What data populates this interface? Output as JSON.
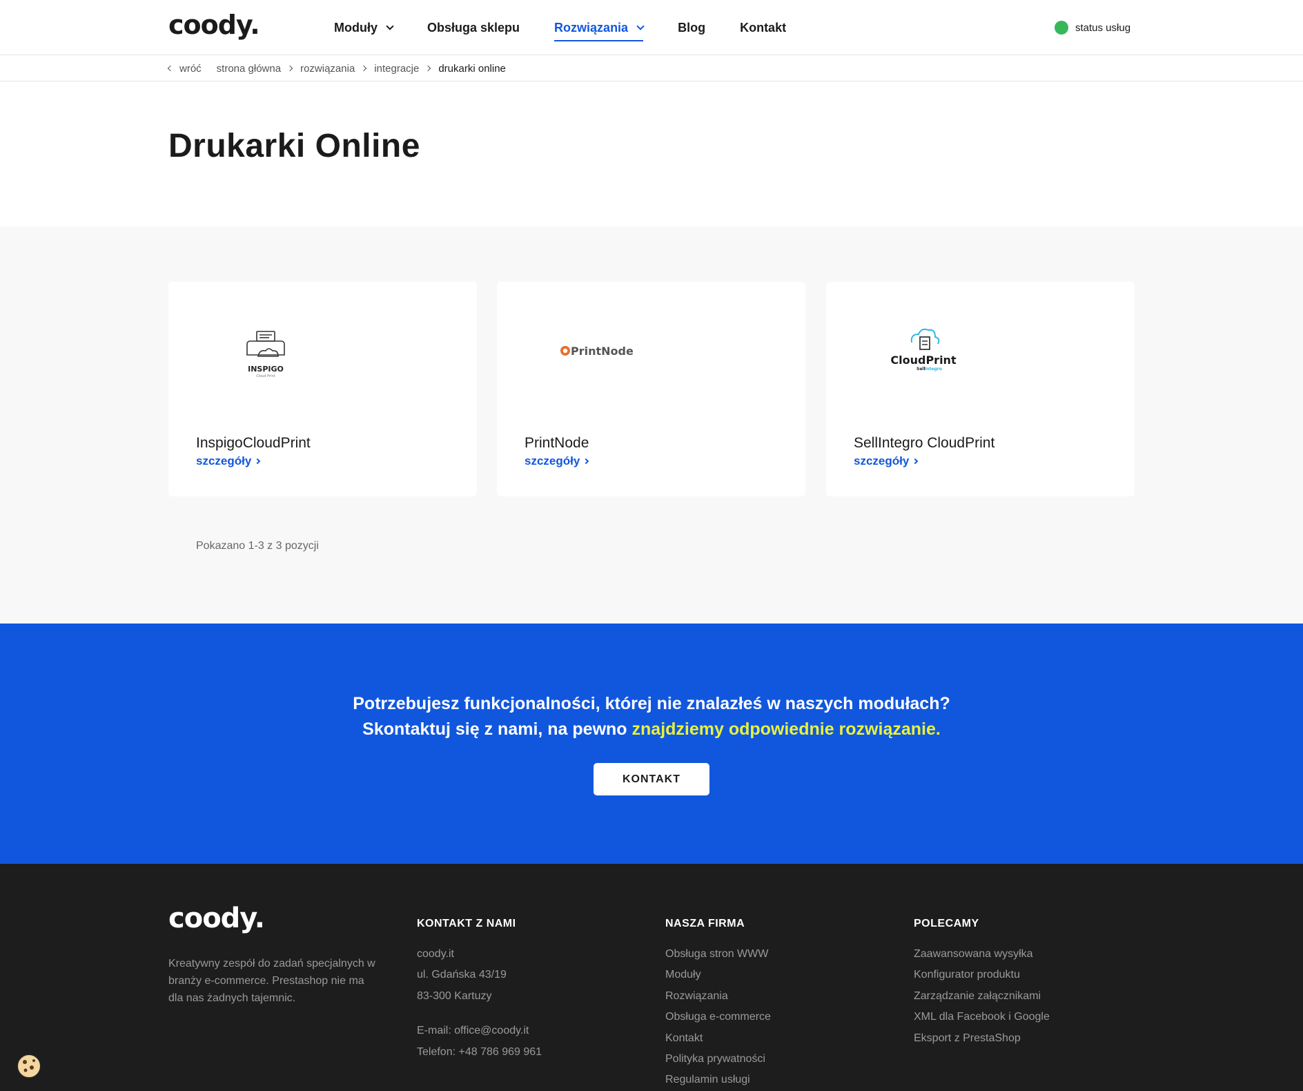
{
  "header": {
    "logo": "coody.",
    "nav": [
      {
        "label": "Moduły",
        "dropdown": true,
        "active": false
      },
      {
        "label": "Obsługa sklepu",
        "dropdown": false,
        "active": false
      },
      {
        "label": "Rozwiązania",
        "dropdown": true,
        "active": true
      },
      {
        "label": "Blog",
        "dropdown": false,
        "active": false
      },
      {
        "label": "Kontakt",
        "dropdown": false,
        "active": false
      }
    ],
    "status_label": "status usług",
    "status_color": "#36b75a"
  },
  "breadcrumb": {
    "back": "wróć",
    "items": [
      "strona główna",
      "rozwiązania",
      "integracje",
      "drukarki online"
    ]
  },
  "page_title": "Drukarki Online",
  "cards": [
    {
      "title": "InspigoCloudPrint",
      "link": "szczegóły",
      "logo_text": "INSPIGO",
      "logo_sub": "Cloud Print",
      "icon": "printer-cloud-icon"
    },
    {
      "title": "PrintNode",
      "link": "szczegóły",
      "logo_text": "PrintNode",
      "icon": "printnode-logo"
    },
    {
      "title": "SellIntegro CloudPrint",
      "link": "szczegóły",
      "logo_text": "CloudPrint",
      "logo_sub_a": "Sell",
      "logo_sub_b": "Integro",
      "icon": "cloud-printer-icon"
    }
  ],
  "count_text": "Pokazano 1-3 z 3 pozycji",
  "cta": {
    "line1": "Potrzebujesz funkcjonalności, której nie znalazłeś w naszych modułach?",
    "line2_plain": "Skontaktuj się z nami, na pewno ",
    "line2_highlight": "znajdziemy odpowiednie rozwiązanie.",
    "button": "KONTAKT"
  },
  "footer": {
    "logo": "coody.",
    "description": "Kreatywny zespół do zadań specjalnych w branży e-commerce. Prestashop nie ma dla nas żadnych tajemnic.",
    "contact": {
      "heading": "KONTAKT Z NAMI",
      "lines": [
        "coody.it",
        "ul. Gdańska 43/19",
        "83-300 Kartuzy"
      ],
      "email": "E-mail: office@coody.it",
      "phone": "Telefon: +48 786 969 961"
    },
    "company": {
      "heading": "NASZA FIRMA",
      "links": [
        "Obsługa stron WWW",
        "Moduły",
        "Rozwiązania",
        "Obsługa e-commerce",
        "Kontakt",
        "Polityka prywatności",
        "Regulamin usługi"
      ]
    },
    "recommend": {
      "heading": "POLECAMY",
      "links": [
        "Zaawansowana wysyłka",
        "Konfigurator produktu",
        "Zarządzanie załącznikami",
        "XML dla Facebook i Google",
        "Eksport z PrestaShop"
      ]
    }
  },
  "colors": {
    "accent": "#1157de",
    "highlight": "#e9f23b",
    "footer_bg": "#1d1d1d"
  }
}
